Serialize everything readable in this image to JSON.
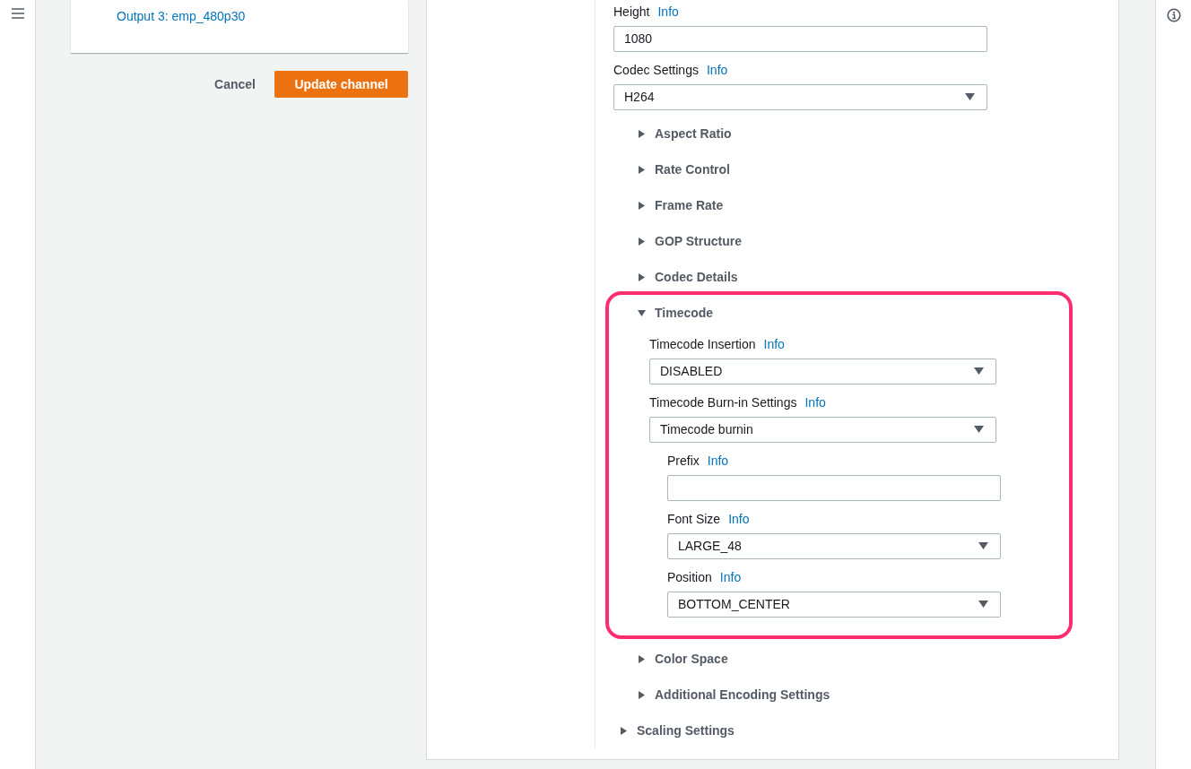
{
  "outputs": [
    "Output 3: emp_480p30"
  ],
  "actions": [
    {
      "label": "Cancel",
      "kind": "link"
    },
    {
      "label": "Update channel",
      "kind": "primary"
    }
  ],
  "settings": [
    {
      "kind": "input",
      "label": "Height",
      "info": "Info",
      "value": "1080"
    },
    {
      "kind": "select",
      "label": "Codec Settings",
      "info": "Info",
      "value": "H264"
    },
    {
      "kind": "section",
      "label": "Aspect Ratio",
      "expanded": false,
      "highlighted": false
    },
    {
      "kind": "section",
      "label": "Rate Control",
      "expanded": false,
      "highlighted": false
    },
    {
      "kind": "section",
      "label": "Frame Rate",
      "expanded": false,
      "highlighted": false
    },
    {
      "kind": "section",
      "label": "GOP Structure",
      "expanded": false,
      "highlighted": false
    },
    {
      "kind": "section",
      "label": "Codec Details",
      "expanded": false,
      "highlighted": false
    },
    {
      "kind": "section",
      "label": "Timecode",
      "expanded": true,
      "highlighted": true,
      "children": [
        {
          "kind": "select",
          "label": "Timecode Insertion",
          "info": "Info",
          "value": "DISABLED"
        },
        {
          "kind": "select",
          "label": "Timecode Burn-in Settings",
          "info": "Info",
          "value": "Timecode burnin"
        },
        {
          "kind": "group",
          "children": [
            {
              "kind": "input",
              "label": "Prefix",
              "info": "Info"
            },
            {
              "kind": "select",
              "label": "Font Size",
              "info": "Info",
              "value": "LARGE_48"
            },
            {
              "kind": "select",
              "label": "Position",
              "info": "Info",
              "value": "BOTTOM_CENTER"
            }
          ]
        }
      ]
    },
    {
      "kind": "section",
      "label": "Color Space",
      "expanded": false,
      "highlighted": false
    },
    {
      "kind": "section",
      "label": "Additional Encoding Settings",
      "expanded": false,
      "highlighted": false
    }
  ],
  "outer_sections": [
    {
      "label": "Scaling Settings",
      "expanded": false
    }
  ]
}
